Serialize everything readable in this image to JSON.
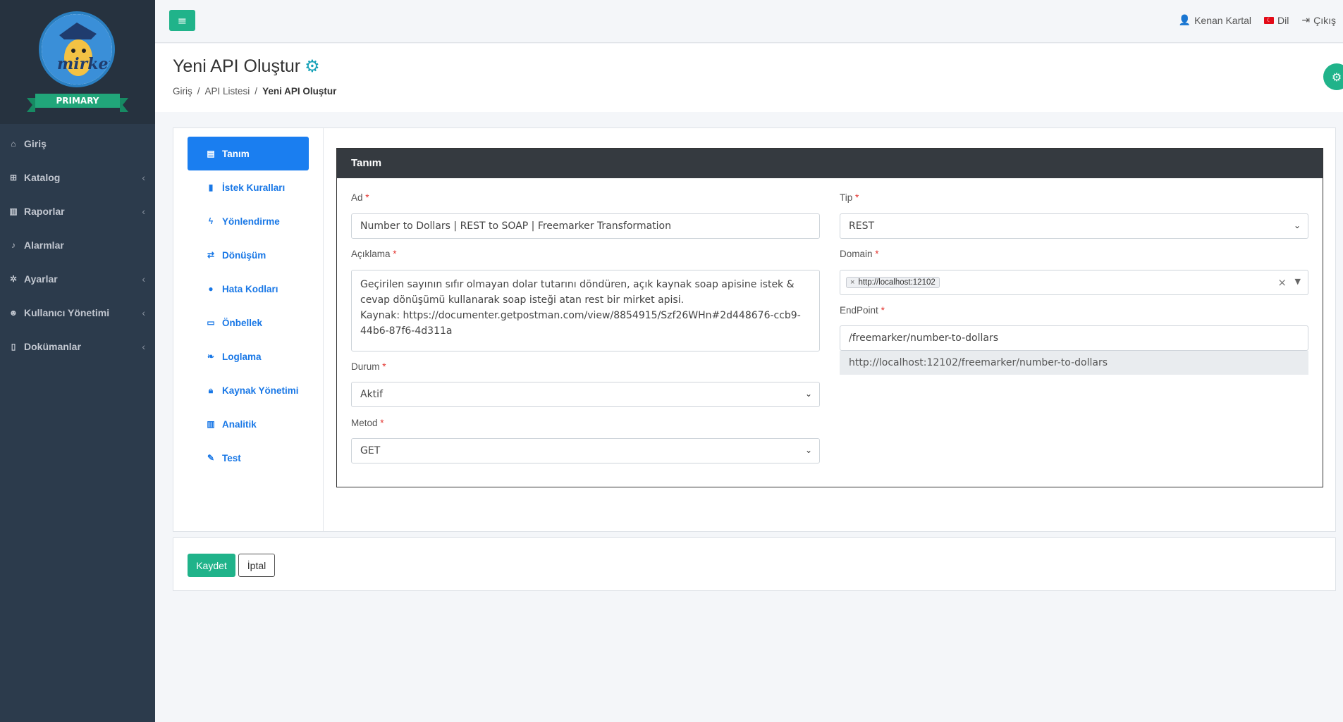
{
  "sidebar": {
    "badge": "PRIMARY",
    "items": [
      {
        "label": "Giriş",
        "icon": "home-icon"
      },
      {
        "label": "Katalog",
        "icon": "sitemap-icon"
      },
      {
        "label": "Raporlar",
        "icon": "chart-icon"
      },
      {
        "label": "Alarmlar",
        "icon": "bell-icon"
      },
      {
        "label": "Ayarlar",
        "icon": "cogs-icon"
      },
      {
        "label": "Kullanıcı Yönetimi",
        "icon": "users-icon"
      },
      {
        "label": "Dokümanlar",
        "icon": "file-icon"
      }
    ]
  },
  "topbar": {
    "user": "Kenan Kartal",
    "language": "Dil",
    "logout": "Çıkış"
  },
  "header": {
    "title": "Yeni API Oluştur",
    "breadcrumb": [
      "Giriş",
      "/",
      "API Listesi",
      "/",
      "Yeni API Oluştur"
    ]
  },
  "tabs": [
    {
      "label": "Tanım",
      "active": true
    },
    {
      "label": "İstek Kuralları"
    },
    {
      "label": "Yönlendirme"
    },
    {
      "label": "Dönüşüm"
    },
    {
      "label": "Hata Kodları"
    },
    {
      "label": "Önbellek"
    },
    {
      "label": "Loglama"
    },
    {
      "label": "Kaynak Yönetimi"
    },
    {
      "label": "Analitik"
    },
    {
      "label": "Test"
    }
  ],
  "form": {
    "section_title": "Tanım",
    "ad_label": "Ad",
    "ad_value": "Number to Dollars | REST to SOAP | Freemarker Transformation",
    "aciklama_label": "Açıklama",
    "aciklama_value": "Geçirilen sayının sıfır olmayan dolar tutarını döndüren, açık kaynak soap apisine istek & cevap dönüşümü kullanarak soap isteği atan rest bir mirket apisi.\nKaynak: https://documenter.getpostman.com/view/8854915/Szf26WHn#2d448676-ccb9-44b6-87f6-4d311a",
    "durum_label": "Durum",
    "durum_value": "Aktif",
    "metod_label": "Metod",
    "metod_value": "GET",
    "tip_label": "Tip",
    "tip_value": "REST",
    "domain_label": "Domain",
    "domain_tag": "http://localhost:12102",
    "endpoint_label": "EndPoint",
    "endpoint_value": "/freemarker/number-to-dollars",
    "endpoint_preview": "http://localhost:12102/freemarker/number-to-dollars",
    "required_mark": "*"
  },
  "actions": {
    "save": "Kaydet",
    "cancel": "İptal"
  },
  "colors": {
    "sidebar_bg": "#2c3b4c",
    "accent_green": "#20b38a",
    "tab_active": "#1a7ef0",
    "section_head": "#353a40"
  }
}
